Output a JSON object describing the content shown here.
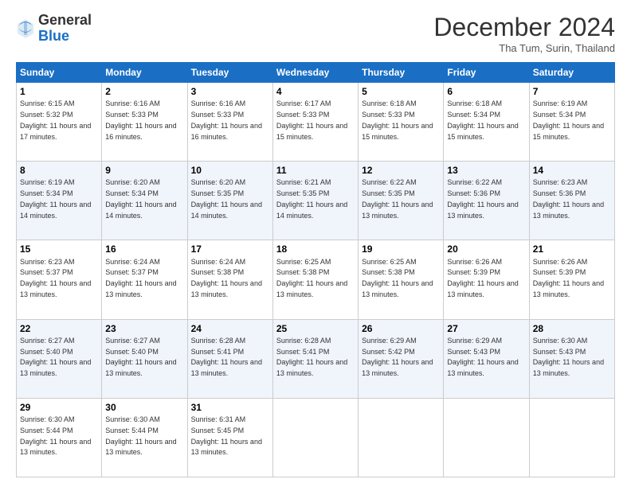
{
  "logo": {
    "general": "General",
    "blue": "Blue"
  },
  "header": {
    "month": "December 2024",
    "location": "Tha Tum, Surin, Thailand"
  },
  "days_of_week": [
    "Sunday",
    "Monday",
    "Tuesday",
    "Wednesday",
    "Thursday",
    "Friday",
    "Saturday"
  ],
  "weeks": [
    [
      {
        "day": "1",
        "sunrise": "6:15 AM",
        "sunset": "5:32 PM",
        "daylight": "11 hours and 17 minutes."
      },
      {
        "day": "2",
        "sunrise": "6:16 AM",
        "sunset": "5:33 PM",
        "daylight": "11 hours and 16 minutes."
      },
      {
        "day": "3",
        "sunrise": "6:16 AM",
        "sunset": "5:33 PM",
        "daylight": "11 hours and 16 minutes."
      },
      {
        "day": "4",
        "sunrise": "6:17 AM",
        "sunset": "5:33 PM",
        "daylight": "11 hours and 15 minutes."
      },
      {
        "day": "5",
        "sunrise": "6:18 AM",
        "sunset": "5:33 PM",
        "daylight": "11 hours and 15 minutes."
      },
      {
        "day": "6",
        "sunrise": "6:18 AM",
        "sunset": "5:34 PM",
        "daylight": "11 hours and 15 minutes."
      },
      {
        "day": "7",
        "sunrise": "6:19 AM",
        "sunset": "5:34 PM",
        "daylight": "11 hours and 15 minutes."
      }
    ],
    [
      {
        "day": "8",
        "sunrise": "6:19 AM",
        "sunset": "5:34 PM",
        "daylight": "11 hours and 14 minutes."
      },
      {
        "day": "9",
        "sunrise": "6:20 AM",
        "sunset": "5:34 PM",
        "daylight": "11 hours and 14 minutes."
      },
      {
        "day": "10",
        "sunrise": "6:20 AM",
        "sunset": "5:35 PM",
        "daylight": "11 hours and 14 minutes."
      },
      {
        "day": "11",
        "sunrise": "6:21 AM",
        "sunset": "5:35 PM",
        "daylight": "11 hours and 14 minutes."
      },
      {
        "day": "12",
        "sunrise": "6:22 AM",
        "sunset": "5:35 PM",
        "daylight": "11 hours and 13 minutes."
      },
      {
        "day": "13",
        "sunrise": "6:22 AM",
        "sunset": "5:36 PM",
        "daylight": "11 hours and 13 minutes."
      },
      {
        "day": "14",
        "sunrise": "6:23 AM",
        "sunset": "5:36 PM",
        "daylight": "11 hours and 13 minutes."
      }
    ],
    [
      {
        "day": "15",
        "sunrise": "6:23 AM",
        "sunset": "5:37 PM",
        "daylight": "11 hours and 13 minutes."
      },
      {
        "day": "16",
        "sunrise": "6:24 AM",
        "sunset": "5:37 PM",
        "daylight": "11 hours and 13 minutes."
      },
      {
        "day": "17",
        "sunrise": "6:24 AM",
        "sunset": "5:38 PM",
        "daylight": "11 hours and 13 minutes."
      },
      {
        "day": "18",
        "sunrise": "6:25 AM",
        "sunset": "5:38 PM",
        "daylight": "11 hours and 13 minutes."
      },
      {
        "day": "19",
        "sunrise": "6:25 AM",
        "sunset": "5:38 PM",
        "daylight": "11 hours and 13 minutes."
      },
      {
        "day": "20",
        "sunrise": "6:26 AM",
        "sunset": "5:39 PM",
        "daylight": "11 hours and 13 minutes."
      },
      {
        "day": "21",
        "sunrise": "6:26 AM",
        "sunset": "5:39 PM",
        "daylight": "11 hours and 13 minutes."
      }
    ],
    [
      {
        "day": "22",
        "sunrise": "6:27 AM",
        "sunset": "5:40 PM",
        "daylight": "11 hours and 13 minutes."
      },
      {
        "day": "23",
        "sunrise": "6:27 AM",
        "sunset": "5:40 PM",
        "daylight": "11 hours and 13 minutes."
      },
      {
        "day": "24",
        "sunrise": "6:28 AM",
        "sunset": "5:41 PM",
        "daylight": "11 hours and 13 minutes."
      },
      {
        "day": "25",
        "sunrise": "6:28 AM",
        "sunset": "5:41 PM",
        "daylight": "11 hours and 13 minutes."
      },
      {
        "day": "26",
        "sunrise": "6:29 AM",
        "sunset": "5:42 PM",
        "daylight": "11 hours and 13 minutes."
      },
      {
        "day": "27",
        "sunrise": "6:29 AM",
        "sunset": "5:43 PM",
        "daylight": "11 hours and 13 minutes."
      },
      {
        "day": "28",
        "sunrise": "6:30 AM",
        "sunset": "5:43 PM",
        "daylight": "11 hours and 13 minutes."
      }
    ],
    [
      {
        "day": "29",
        "sunrise": "6:30 AM",
        "sunset": "5:44 PM",
        "daylight": "11 hours and 13 minutes."
      },
      {
        "day": "30",
        "sunrise": "6:30 AM",
        "sunset": "5:44 PM",
        "daylight": "11 hours and 13 minutes."
      },
      {
        "day": "31",
        "sunrise": "6:31 AM",
        "sunset": "5:45 PM",
        "daylight": "11 hours and 13 minutes."
      },
      null,
      null,
      null,
      null
    ]
  ],
  "labels": {
    "sunrise": "Sunrise:",
    "sunset": "Sunset:",
    "daylight": "Daylight:"
  }
}
